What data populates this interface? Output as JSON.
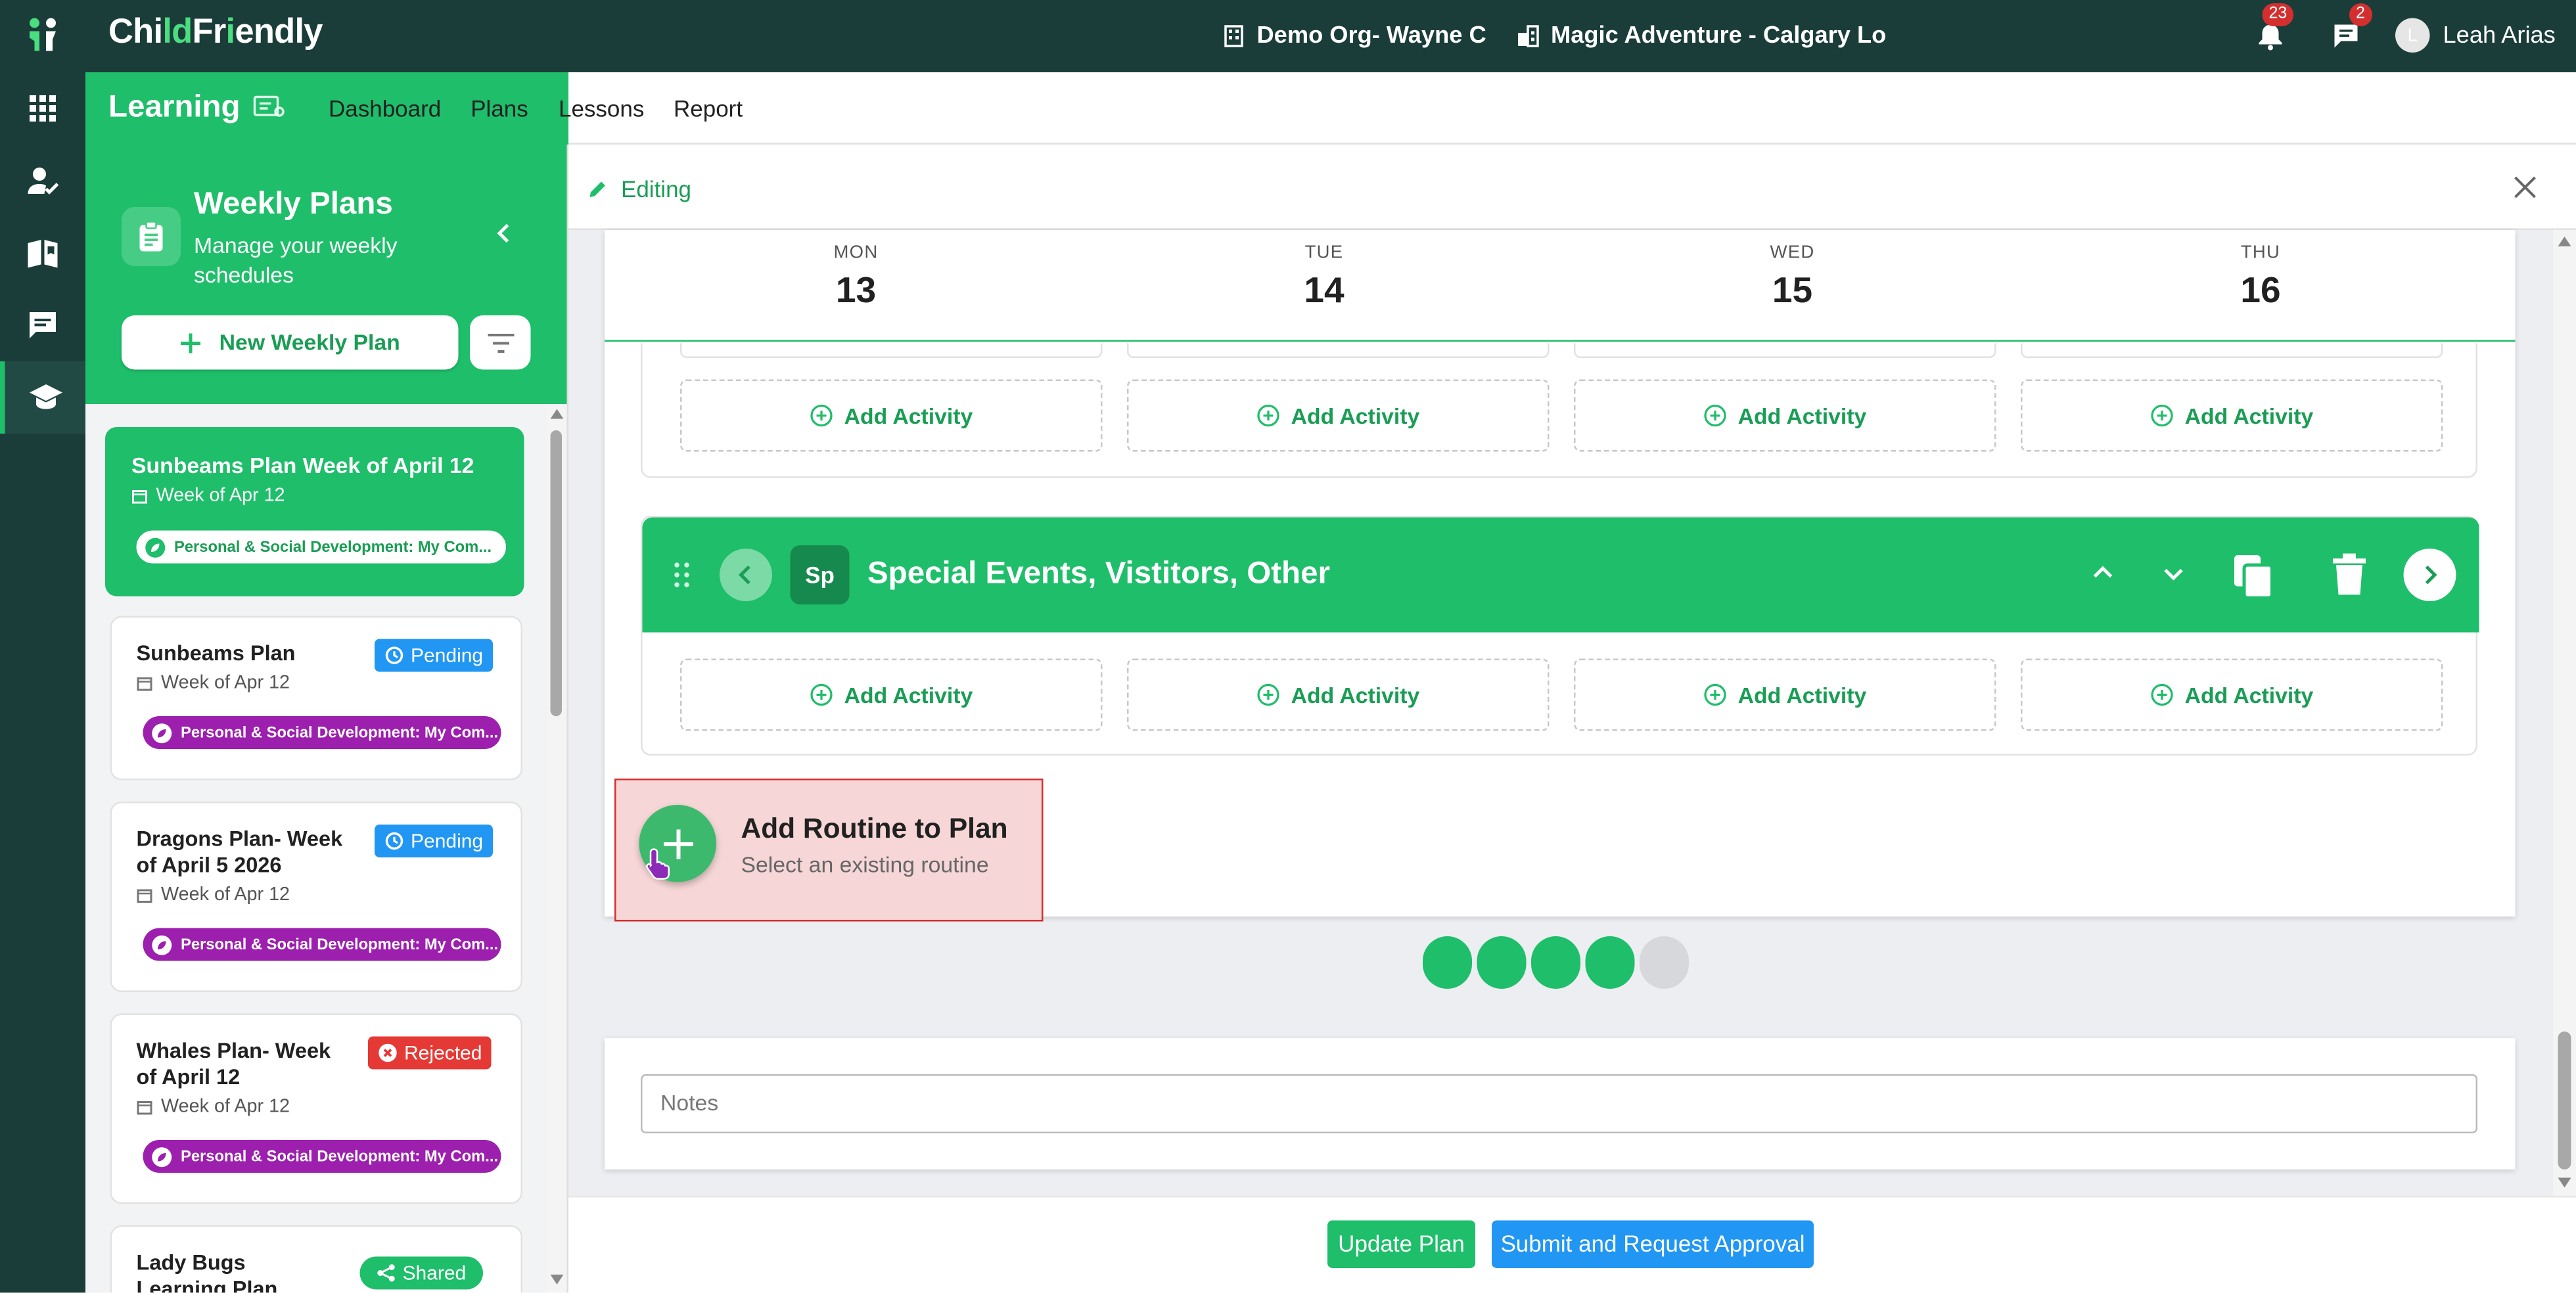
{
  "app": {
    "logo_part1": "Chi",
    "logo_part2": "ld",
    "logo_part3": "Fr",
    "logo_part4": "i",
    "logo_part5": "endly",
    "org": "Demo Org- Wayne C",
    "location": "Magic Adventure - Calgary Lo",
    "notifications_count": "23",
    "messages_count": "2",
    "user_initial": "L",
    "user_name": "Leah Arias"
  },
  "rail": {
    "items": [
      "apps-grid",
      "user-check",
      "book",
      "chat",
      "learning"
    ],
    "active": "learning"
  },
  "module": {
    "title": "Learning",
    "tabs": [
      {
        "label": "Dashboard",
        "active": false
      },
      {
        "label": "Plans",
        "active": true
      },
      {
        "label": "Lessons",
        "active": false
      },
      {
        "label": "Report",
        "active": false
      }
    ]
  },
  "sidebar": {
    "title": "Weekly Plans",
    "subtitle_line1": "Manage your weekly",
    "subtitle_line2": "schedules",
    "new_button": "New Weekly Plan",
    "plans": [
      {
        "title": "Sunbeams Plan Week of April 12",
        "week": "Week of Apr 12",
        "tag": "Personal & Social Development: My Com...",
        "status": "",
        "selected": true
      },
      {
        "title": "Sunbeams Plan",
        "week": "Week of Apr 12",
        "tag": "Personal & Social Development: My Com...",
        "status": "Pending"
      },
      {
        "title_line1": "Dragons Plan- Week",
        "title_line2": "of April 5 2026",
        "week": "Week of Apr 12",
        "tag": "Personal & Social Development: My Com...",
        "status": "Pending"
      },
      {
        "title_line1": "Whales Plan- Week",
        "title_line2": "of April 12",
        "week": "Week of Apr 12",
        "tag": "Personal & Social Development: My Com...",
        "status": "Rejected"
      },
      {
        "title_line1": "Lady Bugs",
        "title_line2": "Learning Plan",
        "status": "Shared"
      }
    ]
  },
  "editor": {
    "mode_label": "Editing",
    "days": [
      {
        "name": "MON",
        "date": "13"
      },
      {
        "name": "TUE",
        "date": "14"
      },
      {
        "name": "WED",
        "date": "15"
      },
      {
        "name": "THU",
        "date": "16"
      }
    ],
    "add_activity_label": "Add Activity",
    "routine": {
      "abbr": "Sp",
      "title": "Special Events, Vistitors, Other"
    },
    "add_routine_title": "Add Routine to Plan",
    "add_routine_subtitle": "Select an existing routine",
    "pagination": {
      "total": 5,
      "completed": 4
    },
    "notes_placeholder": "Notes",
    "update_button": "Update Plan",
    "submit_button": "Submit and Request Approval"
  },
  "colors": {
    "brand_dark": "#1b3d39",
    "brand_green": "#1fbe6a",
    "tag_purple": "#9c1fae",
    "pending_blue": "#2196f3",
    "rejected_red": "#e53935",
    "highlight": "#d32f2f"
  }
}
